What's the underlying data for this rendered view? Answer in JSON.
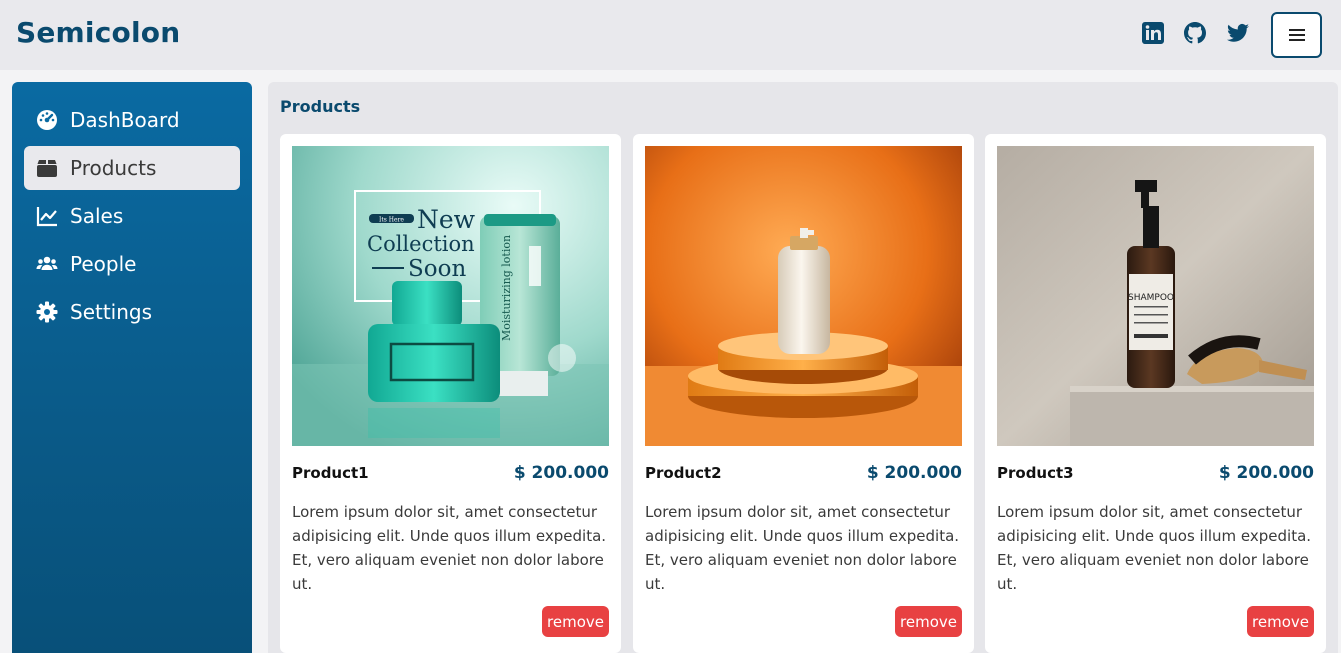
{
  "app": {
    "brand": "Semicolon"
  },
  "header": {
    "social": [
      "linkedin-icon",
      "github-icon",
      "twitter-icon"
    ],
    "menu_icon": "hamburger-icon"
  },
  "sidebar": {
    "items": [
      {
        "label": "DashBoard",
        "icon": "dashboard-icon",
        "active": false
      },
      {
        "label": "Products",
        "icon": "box-icon",
        "active": true
      },
      {
        "label": "Sales",
        "icon": "chart-line-icon",
        "active": false
      },
      {
        "label": "People",
        "icon": "users-icon",
        "active": false
      },
      {
        "label": "Settings",
        "icon": "gear-icon",
        "active": false
      }
    ]
  },
  "main": {
    "title": "Products",
    "products": [
      {
        "name": "Product1",
        "price": "$ 200.000",
        "description": "Lorem ipsum dolor sit, amet consectetur adipisicing elit. Unde quos illum expedita. Et, vero aliquam eveniet non dolor labore ut.",
        "remove_label": "remove",
        "image_text": {
          "badge": "Its Here",
          "line1": "New",
          "line2": "Collection",
          "line3": "Soon",
          "tube": "Moisturizing lotion"
        }
      },
      {
        "name": "Product2",
        "price": "$ 200.000",
        "description": "Lorem ipsum dolor sit, amet consectetur adipisicing elit. Unde quos illum expedita. Et, vero aliquam eveniet non dolor labore ut.",
        "remove_label": "remove"
      },
      {
        "name": "Product3",
        "price": "$ 200.000",
        "description": "Lorem ipsum dolor sit, amet consectetur adipisicing elit. Unde quos illum expedita. Et, vero aliquam eveniet non dolor labore ut.",
        "remove_label": "remove",
        "image_text": {
          "label": "SHAMPOO"
        }
      }
    ]
  },
  "colors": {
    "brand": "#0a4a6e",
    "sidebar": "#0a6aa2",
    "remove": "#e84142",
    "header_bg": "#e9e9ed"
  }
}
